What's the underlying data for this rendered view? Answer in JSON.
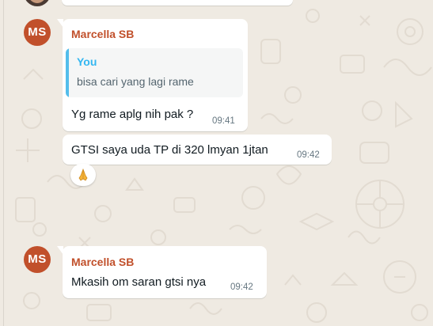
{
  "messages": [
    {
      "avatar_initials": "MS",
      "sender": "Marcella SB",
      "quote": {
        "author": "You",
        "text": "bisa cari yang lagi rame"
      },
      "text": "Yg rame aplg nih pak ?",
      "time": "09:41"
    },
    {
      "text": "GTSI saya uda TP di 320 lmyan 1jtan",
      "time": "09:42",
      "reaction": "folded-hands-emoji"
    },
    {
      "avatar_initials": "MS",
      "sender": "Marcella SB",
      "text": "Mkasih om saran gtsi nya",
      "time": "09:42"
    }
  ],
  "colors": {
    "chat_background": "#efeae2",
    "bubble": "#ffffff",
    "sender_name": "#c1502b",
    "avatar_bg": "#c1502b",
    "quote_bar": "#53bdeb",
    "quote_author": "#34b7f1",
    "timestamp": "#667781"
  }
}
